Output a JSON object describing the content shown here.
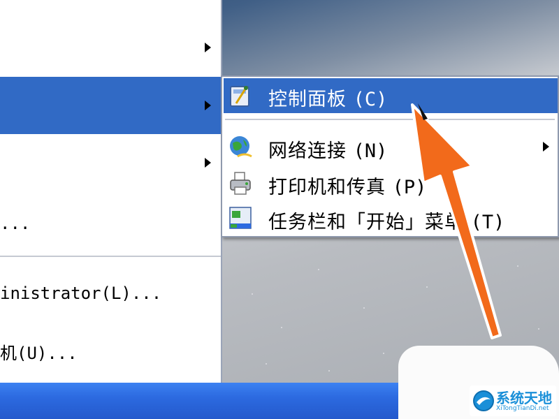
{
  "start_menu": {
    "items": [
      {
        "id": "upper",
        "label": ""
      },
      {
        "id": "settings",
        "label": "",
        "selected": true
      },
      {
        "id": "search",
        "label": ""
      },
      {
        "id": "run",
        "label": "..."
      },
      {
        "id": "logoff",
        "label": "inistrator(L)..."
      },
      {
        "id": "shutdown",
        "label": "机(U)..."
      }
    ]
  },
  "submenu": {
    "items": [
      {
        "id": "control_panel",
        "label": "控制面板",
        "key": "(C)",
        "selected": true,
        "icon": "control-panel-icon"
      },
      {
        "id": "network",
        "label": "网络连接",
        "key": "(N)",
        "has_submenu": true,
        "icon": "network-globe-icon"
      },
      {
        "id": "printers",
        "label": "打印机和传真",
        "key": "(P)",
        "icon": "printer-icon"
      },
      {
        "id": "taskbar",
        "label": "任务栏和「开始」菜单",
        "key": "(T)",
        "icon": "taskbar-settings-icon"
      }
    ]
  },
  "watermark": {
    "title": "系统天地",
    "url": "XiTongTianDi.net"
  },
  "colors": {
    "selection": "#316ac5",
    "taskbar": "#2c6ae0",
    "arrow": "#f26a1b"
  }
}
